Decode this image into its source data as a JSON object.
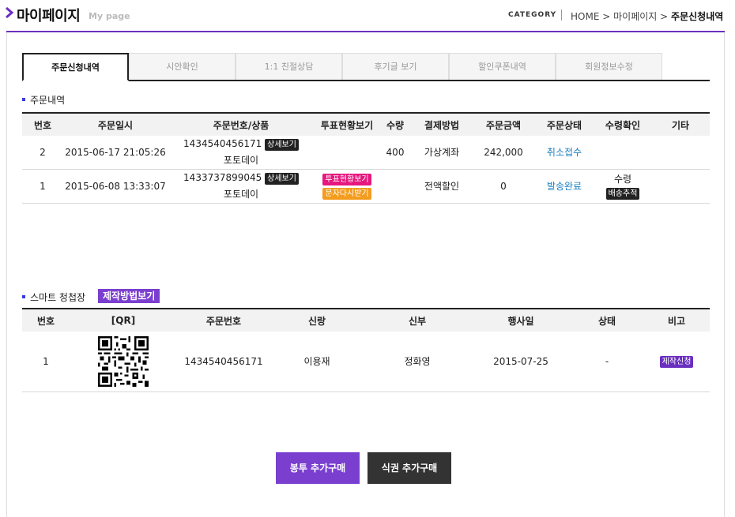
{
  "header": {
    "title": "마이페이지",
    "subtitle": "My page",
    "category_label": "CATEGORY",
    "breadcrumb": [
      "HOME",
      "마이페이지",
      "주문신청내역"
    ],
    "sep": ">"
  },
  "tabs": [
    {
      "label": "주문신청내역",
      "active": true
    },
    {
      "label": "시안확인",
      "active": false
    },
    {
      "label": "1:1 친절상담",
      "active": false
    },
    {
      "label": "후기글 보기",
      "active": false
    },
    {
      "label": "할인쿠폰내역",
      "active": false
    },
    {
      "label": "회원정보수정",
      "active": false
    }
  ],
  "orders": {
    "section_title": "주문내역",
    "columns": [
      "번호",
      "주문일시",
      "주문번호/상품",
      "투표현황보기",
      "수량",
      "결제방법",
      "주문금액",
      "주문상태",
      "수령확인",
      "기타"
    ],
    "rows": [
      {
        "no": "2",
        "date": "2015-06-17 21:05:26",
        "order_no": "1434540456171",
        "detail_btn": "상세보기",
        "product": "포토데이",
        "vote_btn": "",
        "resend_btn": "",
        "qty": "400",
        "pay": "가상계좌",
        "amount": "242,000",
        "status": "취소접수",
        "receive": "",
        "track_btn": "",
        "etc": ""
      },
      {
        "no": "1",
        "date": "2015-06-08 13:33:07",
        "order_no": "1433737899045",
        "detail_btn": "상세보기",
        "product": "포토데이",
        "vote_btn": "투표현황보기",
        "resend_btn": "문자다시받기",
        "qty": "",
        "pay": "전액할인",
        "amount": "0",
        "status": "발송완료",
        "receive": "수령",
        "track_btn": "배송추적",
        "etc": ""
      }
    ]
  },
  "smart": {
    "section_title": "스마트 청첩장",
    "how_btn": "제작방법보기",
    "columns": [
      "번호",
      "[QR]",
      "주문번호",
      "신랑",
      "신부",
      "행사일",
      "상태",
      "비고"
    ],
    "rows": [
      {
        "no": "1",
        "order_no": "1434540456171",
        "groom": "이용재",
        "bride": "정화영",
        "date": "2015-07-25",
        "status": "-",
        "action_btn": "제작신청"
      }
    ]
  },
  "buttons": {
    "envelope": "봉투 추가구매",
    "ticket": "식권 추가구매"
  },
  "colors": {
    "accent": "#6b2fc0",
    "link": "#1a7fc0",
    "pink": "#e6177f",
    "orange": "#f39c1e"
  }
}
